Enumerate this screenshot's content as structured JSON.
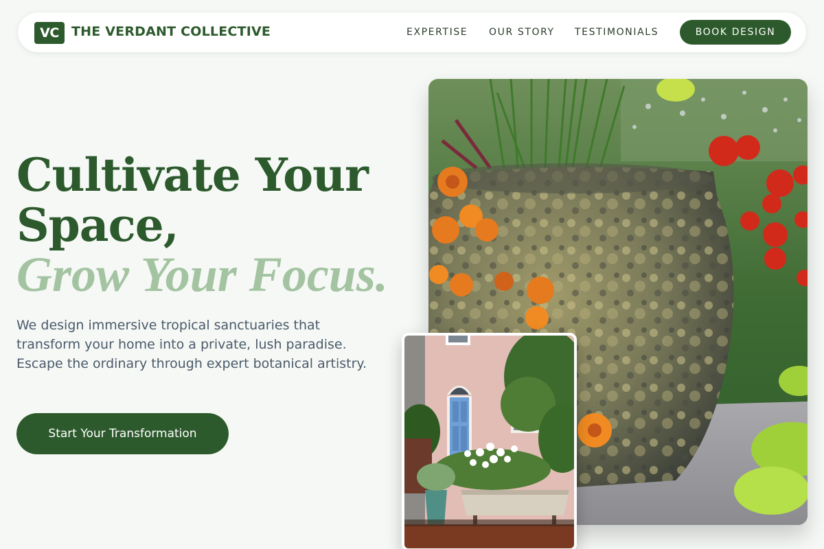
{
  "brand": {
    "logo_initials": "VC",
    "name": "THE VERDANT COLLECTIVE"
  },
  "nav": {
    "links": [
      "EXPERTISE",
      "OUR STORY",
      "TESTIMONIALS"
    ],
    "cta_label": "BOOK DESIGN"
  },
  "hero": {
    "headline_line1": "Cultivate Your",
    "headline_line2": "Space,",
    "headline_accent": "Grow Your Focus.",
    "description": "We design immersive tropical sanctuaries that transform your home into a private, lush paradise. Escape the ordinary through expert botanical artistry.",
    "cta_label": "Start Your Transformation"
  },
  "images": {
    "main_icon": "garden-pot-photo",
    "secondary_icon": "bathtub-garden-photo"
  },
  "colors": {
    "brand_green": "#2d5a2d",
    "accent_sage": "#a3c3a1",
    "background": "#f5f8f5",
    "body_text": "#4a5a6a"
  }
}
